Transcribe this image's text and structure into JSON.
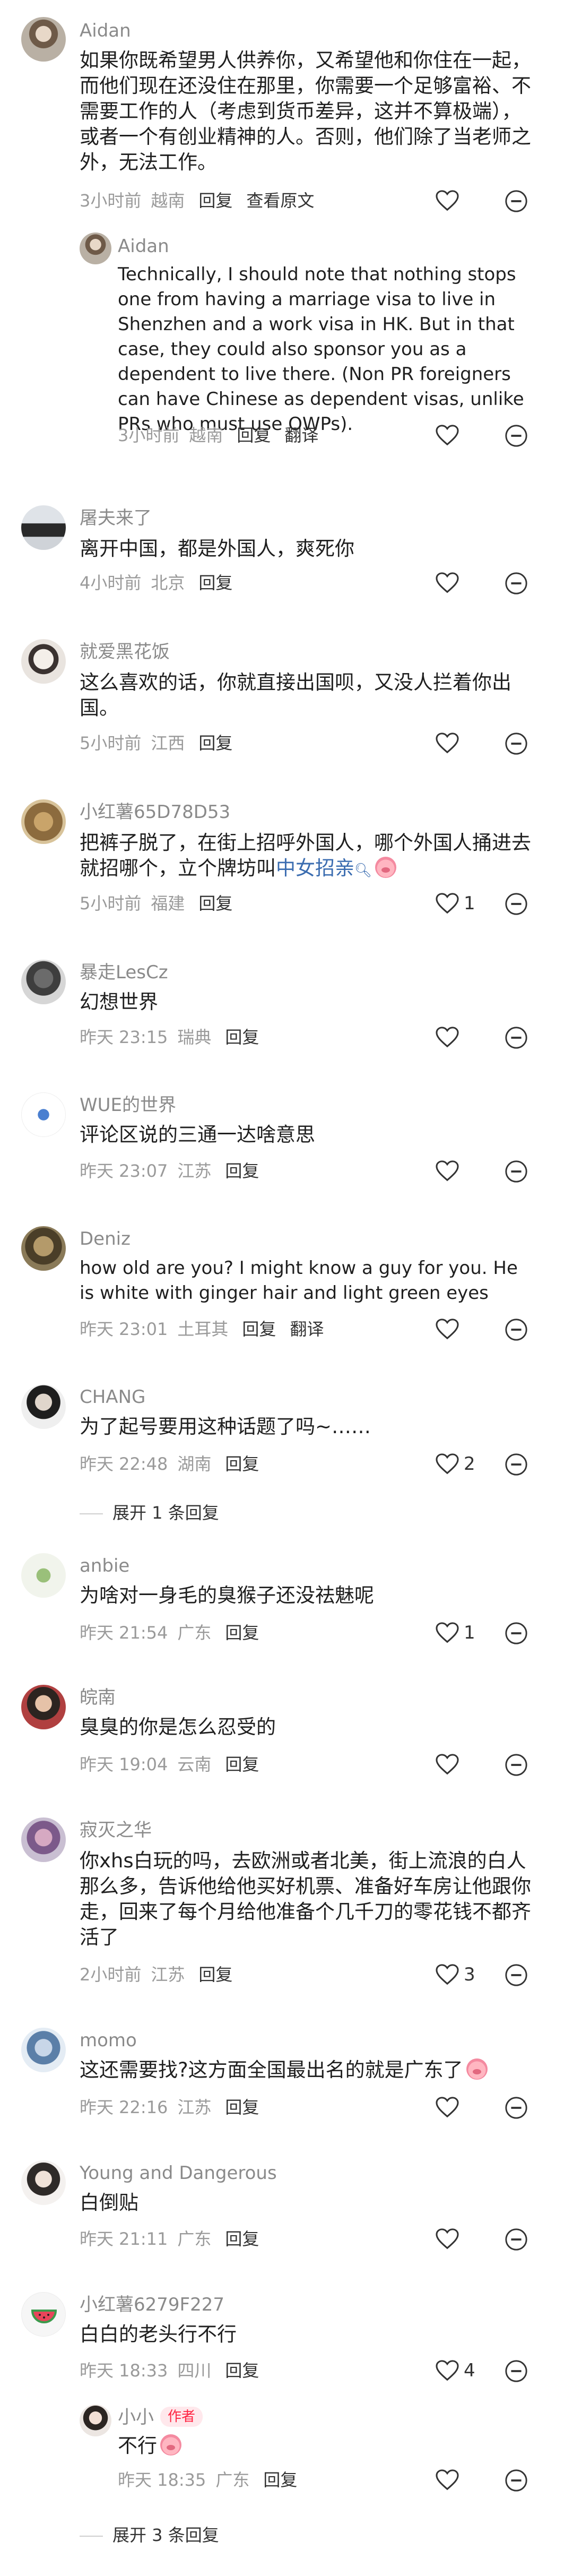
{
  "comments": [
    {
      "author": "Aidan",
      "text": "如果你既希望男人供养你，又希望他和你住在一起，而他们现在还没住在那里，你需要一个足够富裕、不需要工作的人（考虑到货币差异，这并不算极端），或者一个有创业精神的人。否则，他们除了当老师之外，无法工作。",
      "time": "3小时前",
      "location": "越南",
      "actions": [
        "回复",
        "查看原文"
      ],
      "likes": "",
      "reply": {
        "author": "Aidan",
        "text": "Technically, I should note that nothing stops one from having a marriage visa to live in Shenzhen and a work visa in HK. But in that case, they could also sponsor you as a dependent to live there. (Non PR foreigners can have Chinese as dependent visas, unlike PRs who must use OWPs).",
        "time": "3小时前",
        "location": "越南",
        "actions": [
          "回复",
          "翻译"
        ]
      }
    },
    {
      "author": "屠夫来了",
      "text": "离开中国，都是外国人，爽死你",
      "time": "4小时前",
      "location": "北京",
      "actions": [
        "回复"
      ],
      "likes": ""
    },
    {
      "author": "就爱黑花饭",
      "text": "这么喜欢的话，你就直接出国呗，又没人拦着你出国。",
      "time": "5小时前",
      "location": "江西",
      "actions": [
        "回复"
      ],
      "likes": ""
    },
    {
      "author": "小红薯65D78D53",
      "text": "把裤子脱了，在街上招呼外国人，哪个外国人捅进去就招哪个，立个牌坊叫",
      "hashtag": "中女招亲",
      "time": "5小时前",
      "location": "福建",
      "actions": [
        "回复"
      ],
      "likes": "1"
    },
    {
      "author": "暴走LesCz",
      "text": "幻想世界",
      "time": "昨天 23:15",
      "location": "瑞典",
      "actions": [
        "回复"
      ],
      "likes": ""
    },
    {
      "author": "WUE的世界",
      "text": "评论区说的三通一达啥意思",
      "time": "昨天 23:07",
      "location": "江苏",
      "actions": [
        "回复"
      ],
      "likes": ""
    },
    {
      "author": "Deniz",
      "text": "how old are you? I might know a guy for you. He is white with ginger hair and light green eyes",
      "time": "昨天 23:01",
      "location": "土耳其",
      "actions": [
        "回复",
        "翻译"
      ],
      "likes": ""
    },
    {
      "author": "CHANG",
      "text": "为了起号要用这种话题了吗~……",
      "time": "昨天 22:48",
      "location": "湖南",
      "actions": [
        "回复"
      ],
      "likes": "2",
      "expand": "展开 1 条回复"
    },
    {
      "author": "anbie",
      "text": "为啥对一身毛的臭猴子还没祛魅呢",
      "time": "昨天 21:54",
      "location": "广东",
      "actions": [
        "回复"
      ],
      "likes": "1"
    },
    {
      "author": "皖南",
      "text": "臭臭的你是怎么忍受的",
      "time": "昨天 19:04",
      "location": "云南",
      "actions": [
        "回复"
      ],
      "likes": ""
    },
    {
      "author": "寂灭之华",
      "text": "你xhs白玩的吗，去欧洲或者北美，街上流浪的白人那么多，告诉他给他买好机票、准备好车房让他跟你走，回来了每个月给他准备个几千刀的零花钱不都齐活了",
      "time": "2小时前",
      "location": "江苏",
      "actions": [
        "回复"
      ],
      "likes": "3"
    },
    {
      "author": "momo",
      "text": "这还需要找?这方面全国最出名的就是广东了",
      "time": "昨天 22:16",
      "location": "江苏",
      "actions": [
        "回复"
      ],
      "likes": ""
    },
    {
      "author": "Young and Dangerous",
      "text": "白倒贴",
      "time": "昨天 21:11",
      "location": "广东",
      "actions": [
        "回复"
      ],
      "likes": ""
    },
    {
      "author": "小红薯6279F227",
      "text": "白白的老头行不行",
      "time": "昨天 18:33",
      "location": "四川",
      "actions": [
        "回复"
      ],
      "likes": "4",
      "reply": {
        "author": "小小",
        "badge": "作者",
        "text": "不行",
        "time": "昨天 18:35",
        "location": "广东",
        "actions": [
          "回复"
        ]
      },
      "expand": "展开 3 条回复"
    }
  ],
  "icons": {
    "like": "heart-outline-icon",
    "more": "more-options-icon",
    "emoji": "pig-face-emoji"
  },
  "colors": {
    "accent": "#ff2442",
    "muted": "#8a8a8a",
    "hashtag": "#3a6cb0"
  }
}
